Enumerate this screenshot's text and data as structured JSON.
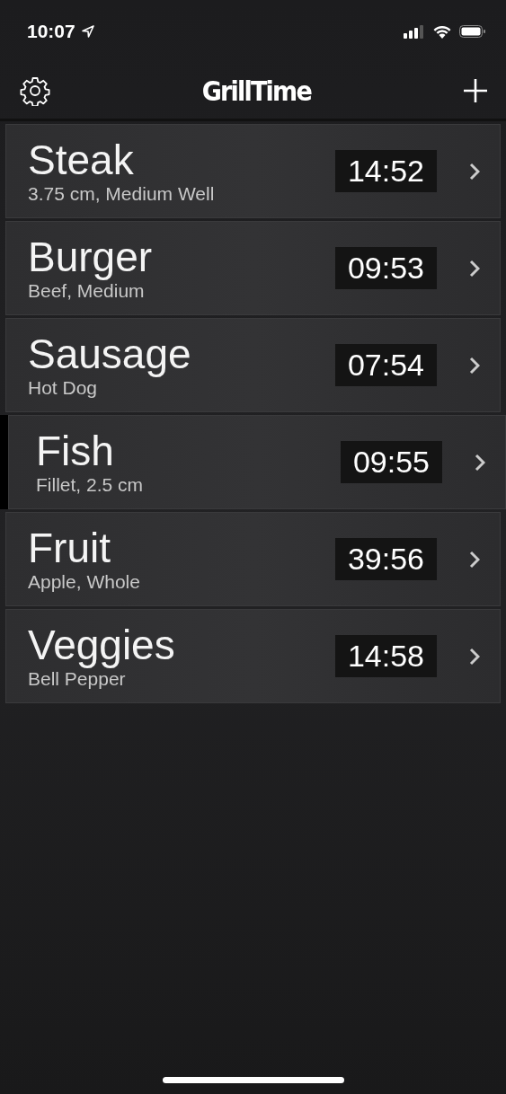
{
  "status_bar": {
    "time": "10:07"
  },
  "nav": {
    "title": "GrillTime"
  },
  "items": [
    {
      "name": "Steak",
      "detail": "3.75 cm, Medium Well",
      "timer": "14:52",
      "shifted": false
    },
    {
      "name": "Burger",
      "detail": "Beef, Medium",
      "timer": "09:53",
      "shifted": false
    },
    {
      "name": "Sausage",
      "detail": "Hot Dog",
      "timer": "07:54",
      "shifted": false
    },
    {
      "name": "Fish",
      "detail": "Fillet, 2.5 cm",
      "timer": "09:55",
      "shifted": true
    },
    {
      "name": "Fruit",
      "detail": "Apple, Whole",
      "timer": "39:56",
      "shifted": false
    },
    {
      "name": "Veggies",
      "detail": "Bell Pepper",
      "timer": "14:58",
      "shifted": false
    }
  ]
}
